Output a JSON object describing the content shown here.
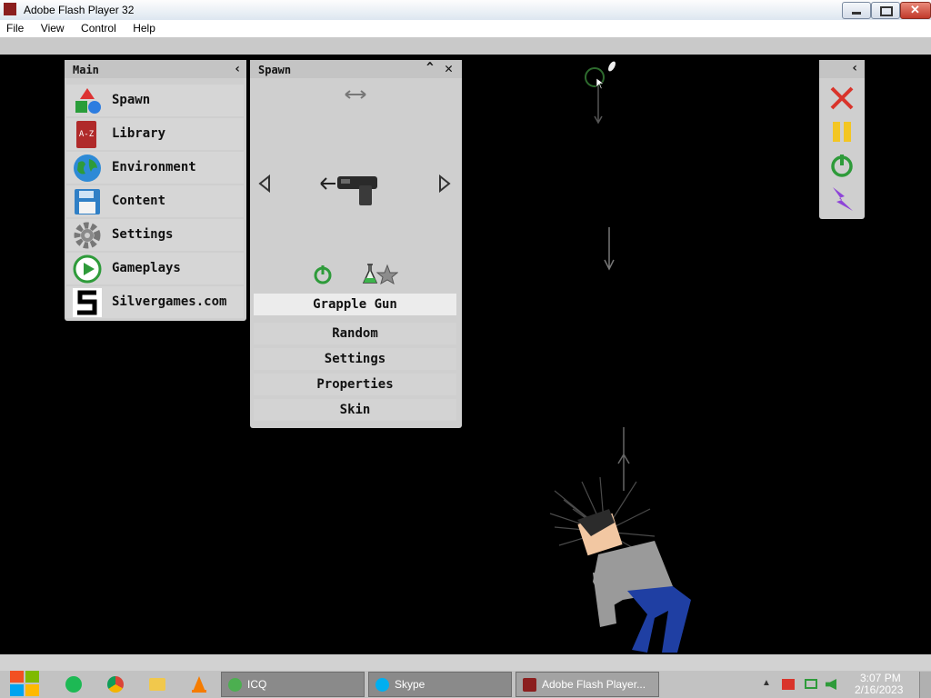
{
  "window": {
    "title": "Adobe Flash Player 32"
  },
  "menu": [
    "File",
    "View",
    "Control",
    "Help"
  ],
  "main_panel": {
    "title": "Main",
    "items": [
      {
        "label": "Spawn",
        "icon": "shapes-icon"
      },
      {
        "label": "Library",
        "icon": "book-az-icon"
      },
      {
        "label": "Environment",
        "icon": "globe-icon"
      },
      {
        "label": "Content",
        "icon": "floppy-disk-icon"
      },
      {
        "label": "Settings",
        "icon": "gear-icon"
      },
      {
        "label": "Gameplays",
        "icon": "play-icon"
      },
      {
        "label": "Silvergames.com",
        "icon": "silvergames-logo-icon"
      }
    ]
  },
  "spawn_panel": {
    "title": "Spawn",
    "selected_item": "Grapple Gun",
    "buttons": [
      "Random",
      "Settings",
      "Properties",
      "Skin"
    ]
  },
  "taskbar": {
    "buttons": [
      {
        "label": "ICQ",
        "icon": "icq-icon"
      },
      {
        "label": "Skype",
        "icon": "skype-icon"
      },
      {
        "label": "Adobe Flash Player...",
        "icon": "flash-icon"
      }
    ],
    "time": "3:07 PM",
    "date": "2/16/2023"
  },
  "colors": {
    "accent_green": "#2e9b3a",
    "close_red": "#d9342b",
    "pause_yellow": "#f3c623",
    "lightning_purple": "#8e44d8"
  }
}
